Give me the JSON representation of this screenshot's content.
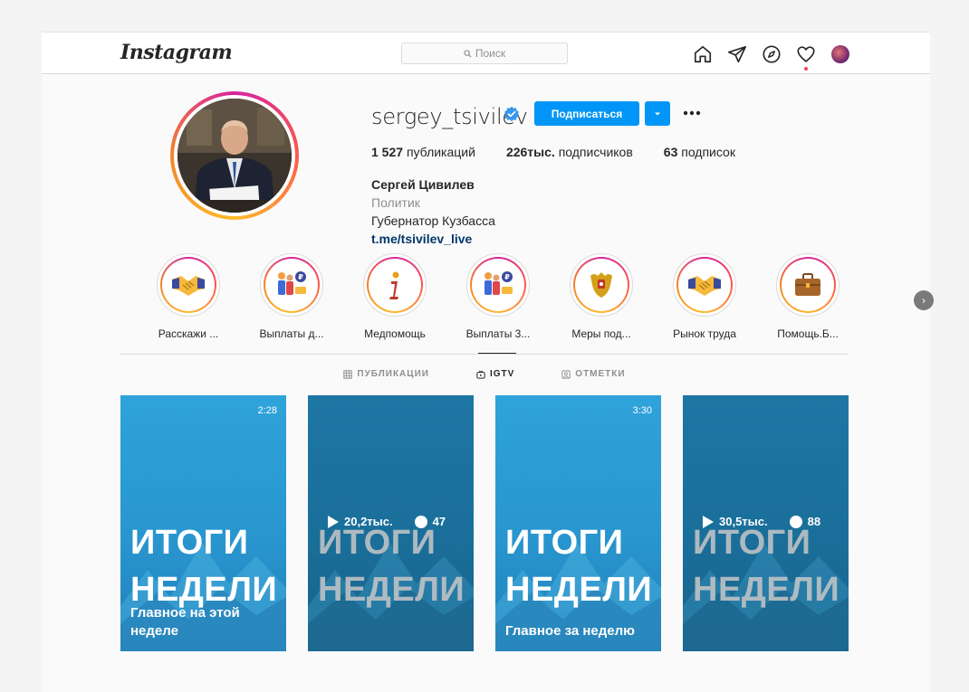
{
  "header": {
    "logo": "Instagram",
    "search_placeholder": "Поиск",
    "nav_icons": [
      "home-icon",
      "direct-icon",
      "explore-icon",
      "activity-icon",
      "profile-avatar"
    ]
  },
  "profile": {
    "username": "sergey_tsivilev",
    "verified": true,
    "follow_label": "Подписаться",
    "stats": {
      "posts_count": "1 527",
      "posts_label": "публикаций",
      "followers_count": "226тыс.",
      "followers_label": "подписчиков",
      "following_count": "63",
      "following_label": "подписок"
    },
    "full_name": "Сергей Цивилев",
    "category": "Политик",
    "bio": "Губернатор Кузбасса",
    "link": "t.me/tsivilev_live"
  },
  "highlights": [
    {
      "label": "Расскажи ...",
      "icon": "handshake-icon"
    },
    {
      "label": "Выплаты д...",
      "icon": "payments-icon"
    },
    {
      "label": "Медпомощь",
      "icon": "info-icon"
    },
    {
      "label": "Выплаты 3...",
      "icon": "payments-icon"
    },
    {
      "label": "Меры под...",
      "icon": "coat-of-arms-icon"
    },
    {
      "label": "Рынок труда",
      "icon": "handshake-icon"
    },
    {
      "label": "Помощь.Б...",
      "icon": "briefcase-icon"
    }
  ],
  "tabs": [
    {
      "label": "ПУБЛИКАЦИИ",
      "icon": "grid-icon",
      "active": false
    },
    {
      "label": "IGTV",
      "icon": "igtv-icon",
      "active": true
    },
    {
      "label": "ОТМЕТКИ",
      "icon": "tagged-icon",
      "active": false
    }
  ],
  "videos": [
    {
      "title_line1": "ИТОГИ",
      "title_line2": "НЕДЕЛИ",
      "duration": "2:28",
      "subtitle": "Главное на этой неделе",
      "views": "",
      "comments": ""
    },
    {
      "title_line1": "ИТОГИ",
      "title_line2": "НЕДЕЛИ",
      "duration": "",
      "subtitle": "",
      "views": "20,2тыс.",
      "comments": "47"
    },
    {
      "title_line1": "ИТОГИ",
      "title_line2": "НЕДЕЛИ",
      "duration": "3:30",
      "subtitle": "Главное за неделю",
      "views": "",
      "comments": ""
    },
    {
      "title_line1": "ИТОГИ",
      "title_line2": "НЕДЕЛИ",
      "duration": "",
      "subtitle": "",
      "views": "30,5тыс.",
      "comments": "88"
    }
  ],
  "colors": {
    "accent": "#0095f6",
    "link": "#00376b",
    "notification": "#ed4956"
  }
}
